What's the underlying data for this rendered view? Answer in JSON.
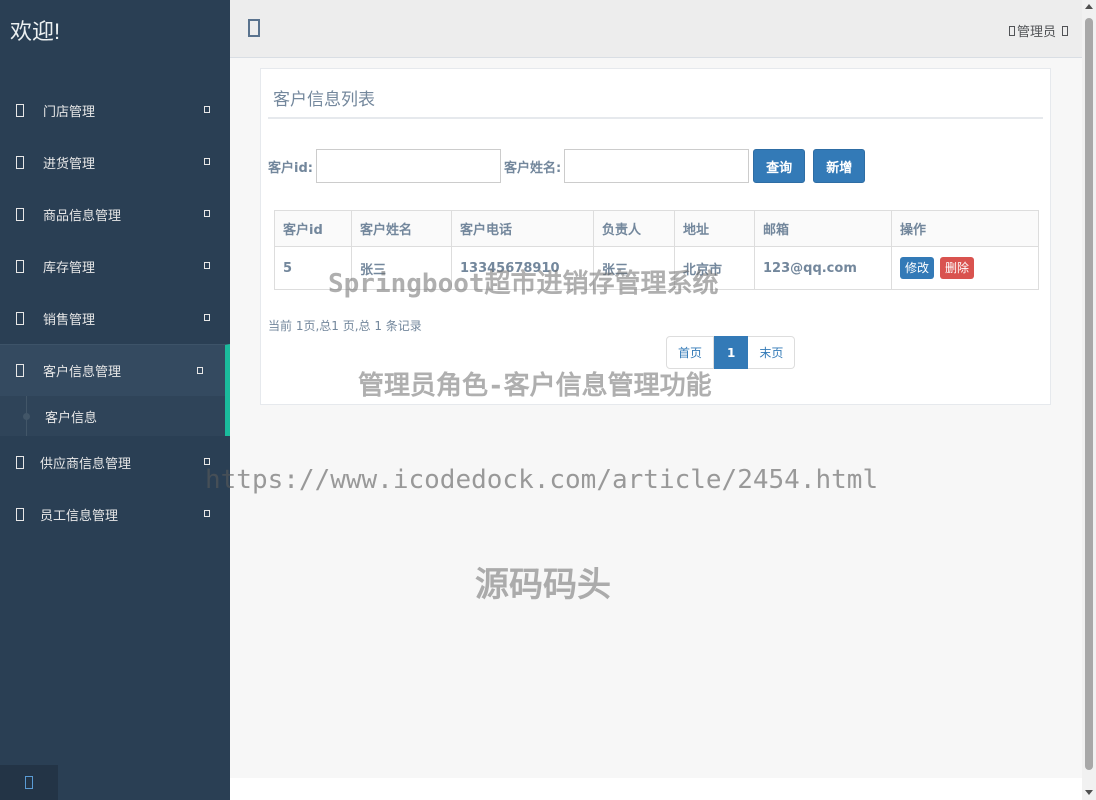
{
  "sidebar": {
    "brand": "欢迎!",
    "items": [
      {
        "label": "门店管理",
        "icon": "square-icon"
      },
      {
        "label": "进货管理",
        "icon": "square-icon"
      },
      {
        "label": "商品信息管理",
        "icon": "square-icon"
      },
      {
        "label": "库存管理",
        "icon": "square-icon"
      },
      {
        "label": "销售管理",
        "icon": "square-icon"
      },
      {
        "label": "客户信息管理",
        "icon": "square-icon"
      },
      {
        "label": "供应商信息管理",
        "icon": "square-icon"
      },
      {
        "label": "员工信息管理",
        "icon": "square-icon"
      }
    ],
    "submenu": {
      "label": "客户信息"
    }
  },
  "topbar": {
    "user_label": "管理员"
  },
  "panel": {
    "title": "客户信息列表"
  },
  "search": {
    "id_label": "客户id:",
    "id_value": "",
    "name_label": "客户姓名:",
    "name_value": "",
    "query_button": "查询",
    "add_button": "新增"
  },
  "table": {
    "headers": [
      "客户id",
      "客户姓名",
      "客户电话",
      "负责人",
      "地址",
      "邮箱",
      "操作"
    ],
    "rows": [
      {
        "id": "5",
        "name": "张三",
        "phone": "13345678910",
        "manager": "张三",
        "address": "北京市",
        "email": "123@qq.com",
        "edit": "修改",
        "delete": "删除"
      }
    ]
  },
  "pagination": {
    "record_info": "当前 1页,总1 页,总 1 条记录",
    "first": "首页",
    "current": "1",
    "last": "末页"
  },
  "watermarks": {
    "line1": "Springboot超市进销存管理系统",
    "line2": "管理员角色-客户信息管理功能",
    "line3": "https://www.icodedock.com/article/2454.html",
    "line4": "源码码头"
  },
  "colors": {
    "sidebar_bg": "#2a3f54",
    "accent": "#1abb9c",
    "primary": "#337ab7",
    "danger": "#d9534f"
  }
}
